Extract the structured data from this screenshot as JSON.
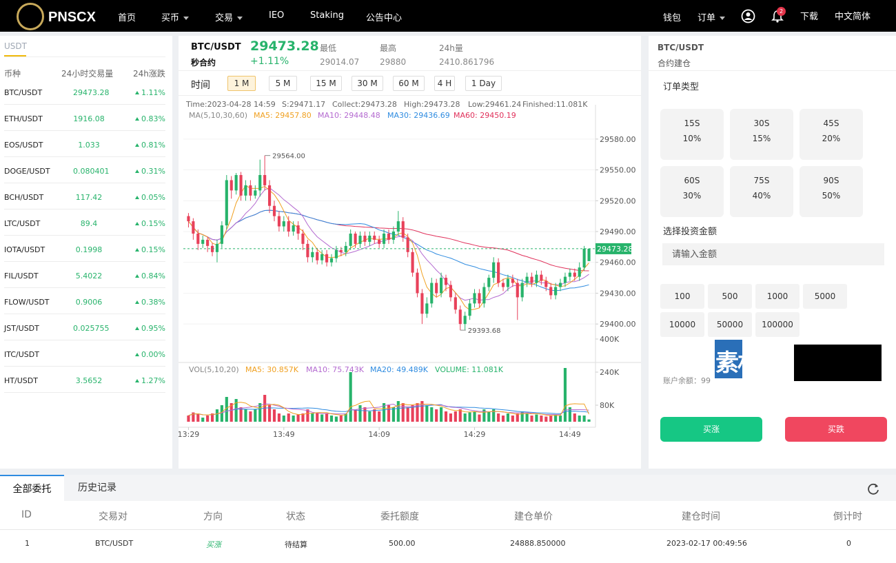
{
  "nav": {
    "logo_text": "PNSCX",
    "items": [
      "首页",
      "买币",
      "交易",
      "IEO",
      "Staking",
      "公告中心"
    ],
    "right": {
      "wallet": "钱包",
      "orders": "订单",
      "notifications": "2",
      "download": "下载",
      "language": "中文简体"
    }
  },
  "market": {
    "tab": "USDT",
    "headers": {
      "pair": "币种",
      "volume": "24小时交易量",
      "change": "24h涨跌"
    },
    "rows": [
      {
        "pair": "BTC/USDT",
        "price": "29473.28",
        "change": "1.11%"
      },
      {
        "pair": "ETH/USDT",
        "price": "1916.08",
        "change": "0.83%"
      },
      {
        "pair": "EOS/USDT",
        "price": "1.033",
        "change": "0.81%"
      },
      {
        "pair": "DOGE/USDT",
        "price": "0.080401",
        "change": "0.31%"
      },
      {
        "pair": "BCH/USDT",
        "price": "117.42",
        "change": "0.05%"
      },
      {
        "pair": "LTC/USDT",
        "price": "89.4",
        "change": "0.15%"
      },
      {
        "pair": "IOTA/USDT",
        "price": "0.1998",
        "change": "0.15%"
      },
      {
        "pair": "FIL/USDT",
        "price": "5.4022",
        "change": "0.84%"
      },
      {
        "pair": "FLOW/USDT",
        "price": "0.9006",
        "change": "0.38%"
      },
      {
        "pair": "JST/USDT",
        "price": "0.025755",
        "change": "0.95%"
      },
      {
        "pair": "ITC/USDT",
        "price": "",
        "change": "0.00%"
      },
      {
        "pair": "HT/USDT",
        "price": "3.5652",
        "change": "1.27%"
      }
    ]
  },
  "ticker": {
    "pair": "BTC/USDT",
    "contract": "秒合约",
    "price": "29473.28",
    "change": "+1.11%",
    "low_label": "最低",
    "low": "29014.07",
    "high_label": "最高",
    "high": "29880",
    "vol_label": "24h量",
    "vol": "2410.861796"
  },
  "timeframes": {
    "label": "时间",
    "options": [
      "1 M",
      "5 M",
      "15 M",
      "30 M",
      "60 M",
      "4 H",
      "1 Day"
    ],
    "active": "1 M"
  },
  "chart_info": {
    "line1": {
      "time": "Time:2023-04-28 14:59",
      "s": "S:29471.17",
      "collect": "Collect:29473.28",
      "high": "High:29473.28",
      "low": "Low:29461.24",
      "finished": "Finished:11.081K"
    },
    "ma": {
      "label": "MA(5,10,30,60)",
      "ma5": "MA5: 29457.80",
      "ma10": "MA10: 29448.48",
      "ma30": "MA30: 29436.69",
      "ma60": "MA60: 29450.19"
    },
    "vol": {
      "label": "VOL(5,10,20)",
      "ma5": "MA5: 30.857K",
      "ma10": "MA10: 75.743K",
      "ma20": "MA20: 49.489K",
      "volume": "VOLUME: 11.081K"
    },
    "price_marker": "29473.28",
    "high_annot": "29564.00",
    "low_annot": "29393.68"
  },
  "chart_data": {
    "type": "candlestick",
    "y_ticks": [
      "29580.00",
      "29550.00",
      "29520.00",
      "29490.00",
      "29460.00",
      "29430.00",
      "29400.00"
    ],
    "vol_ticks": [
      "400K",
      "240K",
      "80K"
    ],
    "x_ticks": [
      "13:29",
      "13:49",
      "14:09",
      "14:29",
      "14:49"
    ],
    "ylim": [
      29380,
      29600
    ],
    "candles": [
      {
        "t": "13:29",
        "o": 29505,
        "c": 29500,
        "h": 29508,
        "l": 29494,
        "v": 30
      },
      {
        "t": "13:30",
        "o": 29500,
        "c": 29488,
        "h": 29503,
        "l": 29482,
        "v": 45
      },
      {
        "t": "13:31",
        "o": 29488,
        "c": 29478,
        "h": 29492,
        "l": 29472,
        "v": 40
      },
      {
        "t": "13:32",
        "o": 29478,
        "c": 29482,
        "h": 29486,
        "l": 29474,
        "v": 20
      },
      {
        "t": "13:33",
        "o": 29482,
        "c": 29476,
        "h": 29485,
        "l": 29470,
        "v": 30
      },
      {
        "t": "13:34",
        "o": 29476,
        "c": 29470,
        "h": 29479,
        "l": 29466,
        "v": 40
      },
      {
        "t": "13:35",
        "o": 29470,
        "c": 29478,
        "h": 29482,
        "l": 29460,
        "v": 60
      },
      {
        "t": "13:36",
        "o": 29478,
        "c": 29496,
        "h": 29500,
        "l": 29474,
        "v": 80
      },
      {
        "t": "13:37",
        "o": 29496,
        "c": 29540,
        "h": 29545,
        "l": 29492,
        "v": 120
      },
      {
        "t": "13:38",
        "o": 29540,
        "c": 29530,
        "h": 29544,
        "l": 29522,
        "v": 90
      },
      {
        "t": "13:39",
        "o": 29530,
        "c": 29545,
        "h": 29547,
        "l": 29526,
        "v": 110
      },
      {
        "t": "13:40",
        "o": 29545,
        "c": 29525,
        "h": 29548,
        "l": 29520,
        "v": 70
      },
      {
        "t": "13:41",
        "o": 29525,
        "c": 29535,
        "h": 29540,
        "l": 29520,
        "v": 60
      },
      {
        "t": "13:42",
        "o": 29535,
        "c": 29525,
        "h": 29540,
        "l": 29520,
        "v": 50
      },
      {
        "t": "13:43",
        "o": 29525,
        "c": 29530,
        "h": 29535,
        "l": 29522,
        "v": 60
      },
      {
        "t": "13:44",
        "o": 29530,
        "c": 29545,
        "h": 29560,
        "l": 29524,
        "v": 90
      },
      {
        "t": "13:45",
        "o": 29545,
        "c": 29535,
        "h": 29564,
        "l": 29530,
        "v": 130
      },
      {
        "t": "13:46",
        "o": 29535,
        "c": 29515,
        "h": 29540,
        "l": 29508,
        "v": 80
      },
      {
        "t": "13:47",
        "o": 29515,
        "c": 29505,
        "h": 29520,
        "l": 29500,
        "v": 60
      },
      {
        "t": "13:48",
        "o": 29505,
        "c": 29495,
        "h": 29510,
        "l": 29490,
        "v": 40
      },
      {
        "t": "13:49",
        "o": 29495,
        "c": 29500,
        "h": 29505,
        "l": 29490,
        "v": 30
      },
      {
        "t": "13:50",
        "o": 29500,
        "c": 29490,
        "h": 29505,
        "l": 29485,
        "v": 40
      },
      {
        "t": "13:51",
        "o": 29490,
        "c": 29496,
        "h": 29500,
        "l": 29486,
        "v": 30
      },
      {
        "t": "13:52",
        "o": 29496,
        "c": 29488,
        "h": 29500,
        "l": 29482,
        "v": 35
      },
      {
        "t": "13:53",
        "o": 29488,
        "c": 29478,
        "h": 29492,
        "l": 29472,
        "v": 40
      },
      {
        "t": "13:54",
        "o": 29478,
        "c": 29465,
        "h": 29482,
        "l": 29460,
        "v": 60
      },
      {
        "t": "13:55",
        "o": 29465,
        "c": 29470,
        "h": 29475,
        "l": 29460,
        "v": 40
      },
      {
        "t": "13:56",
        "o": 29470,
        "c": 29462,
        "h": 29474,
        "l": 29458,
        "v": 45
      },
      {
        "t": "13:57",
        "o": 29462,
        "c": 29468,
        "h": 29472,
        "l": 29458,
        "v": 35
      },
      {
        "t": "13:58",
        "o": 29468,
        "c": 29460,
        "h": 29472,
        "l": 29456,
        "v": 40
      },
      {
        "t": "13:59",
        "o": 29460,
        "c": 29464,
        "h": 29468,
        "l": 29456,
        "v": 30
      },
      {
        "t": "14:00",
        "o": 29464,
        "c": 29472,
        "h": 29476,
        "l": 29460,
        "v": 25
      },
      {
        "t": "14:01",
        "o": 29472,
        "c": 29470,
        "h": 29475,
        "l": 29466,
        "v": 30
      },
      {
        "t": "14:02",
        "o": 29470,
        "c": 29476,
        "h": 29480,
        "l": 29466,
        "v": 40
      },
      {
        "t": "14:03",
        "o": 29476,
        "c": 29488,
        "h": 29492,
        "l": 29472,
        "v": 240
      },
      {
        "t": "14:04",
        "o": 29488,
        "c": 29478,
        "h": 29490,
        "l": 29474,
        "v": 60
      },
      {
        "t": "14:05",
        "o": 29478,
        "c": 29486,
        "h": 29490,
        "l": 29474,
        "v": 80
      },
      {
        "t": "14:06",
        "o": 29486,
        "c": 29480,
        "h": 29490,
        "l": 29476,
        "v": 70
      },
      {
        "t": "14:07",
        "o": 29480,
        "c": 29486,
        "h": 29490,
        "l": 29476,
        "v": 50
      },
      {
        "t": "14:08",
        "o": 29486,
        "c": 29482,
        "h": 29490,
        "l": 29478,
        "v": 60
      },
      {
        "t": "14:09",
        "o": 29482,
        "c": 29478,
        "h": 29486,
        "l": 29474,
        "v": 50
      },
      {
        "t": "14:10",
        "o": 29478,
        "c": 29488,
        "h": 29492,
        "l": 29474,
        "v": 90
      },
      {
        "t": "14:11",
        "o": 29488,
        "c": 29482,
        "h": 29492,
        "l": 29478,
        "v": 80
      },
      {
        "t": "14:12",
        "o": 29482,
        "c": 29490,
        "h": 29495,
        "l": 29478,
        "v": 70
      },
      {
        "t": "14:13",
        "o": 29490,
        "c": 29500,
        "h": 29510,
        "l": 29486,
        "v": 100
      },
      {
        "t": "14:14",
        "o": 29500,
        "c": 29484,
        "h": 29504,
        "l": 29480,
        "v": 90
      },
      {
        "t": "14:15",
        "o": 29484,
        "c": 29470,
        "h": 29488,
        "l": 29465,
        "v": 70
      },
      {
        "t": "14:16",
        "o": 29470,
        "c": 29450,
        "h": 29474,
        "l": 29446,
        "v": 80
      },
      {
        "t": "14:17",
        "o": 29450,
        "c": 29430,
        "h": 29454,
        "l": 29426,
        "v": 90
      },
      {
        "t": "14:18",
        "o": 29430,
        "c": 29410,
        "h": 29434,
        "l": 29400,
        "v": 100
      },
      {
        "t": "14:19",
        "o": 29410,
        "c": 29420,
        "h": 29426,
        "l": 29406,
        "v": 80
      },
      {
        "t": "14:20",
        "o": 29420,
        "c": 29440,
        "h": 29445,
        "l": 29416,
        "v": 70
      },
      {
        "t": "14:21",
        "o": 29440,
        "c": 29430,
        "h": 29444,
        "l": 29426,
        "v": 60
      },
      {
        "t": "14:22",
        "o": 29430,
        "c": 29445,
        "h": 29450,
        "l": 29426,
        "v": 70
      },
      {
        "t": "14:23",
        "o": 29445,
        "c": 29438,
        "h": 29448,
        "l": 29432,
        "v": 50
      },
      {
        "t": "14:24",
        "o": 29438,
        "c": 29426,
        "h": 29442,
        "l": 29422,
        "v": 40
      },
      {
        "t": "14:25",
        "o": 29426,
        "c": 29414,
        "h": 29430,
        "l": 29410,
        "v": 50
      },
      {
        "t": "14:26",
        "o": 29414,
        "c": 29400,
        "h": 29418,
        "l": 29394,
        "v": 60
      },
      {
        "t": "14:27",
        "o": 29400,
        "c": 29408,
        "h": 29412,
        "l": 29394,
        "v": 40
      },
      {
        "t": "14:28",
        "o": 29408,
        "c": 29420,
        "h": 29424,
        "l": 29404,
        "v": 45
      },
      {
        "t": "14:29",
        "o": 29420,
        "c": 29430,
        "h": 29434,
        "l": 29416,
        "v": 50
      },
      {
        "t": "14:30",
        "o": 29430,
        "c": 29420,
        "h": 29434,
        "l": 29416,
        "v": 35
      },
      {
        "t": "14:31",
        "o": 29420,
        "c": 29436,
        "h": 29440,
        "l": 29416,
        "v": 60
      },
      {
        "t": "14:32",
        "o": 29436,
        "c": 29445,
        "h": 29448,
        "l": 29432,
        "v": 50
      },
      {
        "t": "14:33",
        "o": 29445,
        "c": 29460,
        "h": 29465,
        "l": 29440,
        "v": 60
      },
      {
        "t": "14:34",
        "o": 29460,
        "c": 29440,
        "h": 29464,
        "l": 29436,
        "v": 40
      },
      {
        "t": "14:35",
        "o": 29440,
        "c": 29436,
        "h": 29444,
        "l": 29432,
        "v": 30
      },
      {
        "t": "14:36",
        "o": 29436,
        "c": 29444,
        "h": 29448,
        "l": 29432,
        "v": 40
      },
      {
        "t": "14:37",
        "o": 29444,
        "c": 29440,
        "h": 29448,
        "l": 29436,
        "v": 30
      },
      {
        "t": "14:38",
        "o": 29440,
        "c": 29426,
        "h": 29444,
        "l": 29404,
        "v": 40
      },
      {
        "t": "14:39",
        "o": 29426,
        "c": 29440,
        "h": 29444,
        "l": 29422,
        "v": 50
      },
      {
        "t": "14:40",
        "o": 29440,
        "c": 29446,
        "h": 29450,
        "l": 29436,
        "v": 40
      },
      {
        "t": "14:41",
        "o": 29446,
        "c": 29440,
        "h": 29450,
        "l": 29436,
        "v": 30
      },
      {
        "t": "14:42",
        "o": 29440,
        "c": 29448,
        "h": 29452,
        "l": 29436,
        "v": 35
      },
      {
        "t": "14:43",
        "o": 29448,
        "c": 29442,
        "h": 29452,
        "l": 29438,
        "v": 30
      },
      {
        "t": "14:44",
        "o": 29442,
        "c": 29436,
        "h": 29446,
        "l": 29432,
        "v": 25
      },
      {
        "t": "14:45",
        "o": 29436,
        "c": 29428,
        "h": 29440,
        "l": 29424,
        "v": 30
      },
      {
        "t": "14:46",
        "o": 29428,
        "c": 29436,
        "h": 29440,
        "l": 29424,
        "v": 35
      },
      {
        "t": "14:47",
        "o": 29436,
        "c": 29440,
        "h": 29444,
        "l": 29432,
        "v": 30
      },
      {
        "t": "14:48",
        "o": 29440,
        "c": 29446,
        "h": 29450,
        "l": 29436,
        "v": 260
      },
      {
        "t": "14:49",
        "o": 29446,
        "c": 29450,
        "h": 29454,
        "l": 29442,
        "v": 70
      },
      {
        "t": "14:50",
        "o": 29450,
        "c": 29446,
        "h": 29454,
        "l": 29442,
        "v": 40
      },
      {
        "t": "14:51",
        "o": 29446,
        "c": 29455,
        "h": 29460,
        "l": 29442,
        "v": 30
      },
      {
        "t": "14:52",
        "o": 29455,
        "c": 29473.28,
        "h": 29476,
        "l": 29452,
        "v": 30
      },
      {
        "t": "14:53",
        "o": 29461.24,
        "c": 29473.28,
        "h": 29473.28,
        "l": 29461.24,
        "v": 11.081
      }
    ]
  },
  "order_panel": {
    "pair": "BTC/USDT",
    "subtitle": "合约建仓",
    "order_type_label": "订单类型",
    "durations": [
      {
        "time": "15S",
        "rate": "10%"
      },
      {
        "time": "30S",
        "rate": "15%"
      },
      {
        "time": "45S",
        "rate": "20%"
      },
      {
        "time": "60S",
        "rate": "30%"
      },
      {
        "time": "75S",
        "rate": "40%"
      },
      {
        "time": "90S",
        "rate": "50%"
      }
    ],
    "amount_label": "选择投资金额",
    "amount_placeholder": "请输入金额",
    "amounts": [
      "100",
      "500",
      "1000",
      "5000",
      "10000",
      "50000",
      "100000"
    ],
    "balance_label": "账户余额：99",
    "watermark": "素材熟",
    "buy_up": "买涨",
    "buy_down": "买跌"
  },
  "orders": {
    "tabs": [
      "全部委托",
      "历史记录"
    ],
    "headers": [
      "ID",
      "交易对",
      "方向",
      "状态",
      "委托额度",
      "建仓单价",
      "建仓时间",
      "倒计时"
    ],
    "rows": [
      {
        "id": "1",
        "pair": "BTC/USDT",
        "direction": "买涨",
        "status": "待结算",
        "amount": "500.00",
        "price": "24888.850000",
        "time": "2023-02-17 00:49:56",
        "countdown": "0"
      }
    ]
  },
  "colors": {
    "up": "#27b36b",
    "down": "#e8415a",
    "accent": "#f0b90b",
    "ma5": "#f0a020",
    "ma10": "#b46ad0",
    "ma30": "#2e8be0",
    "ma60": "#e0305a"
  }
}
